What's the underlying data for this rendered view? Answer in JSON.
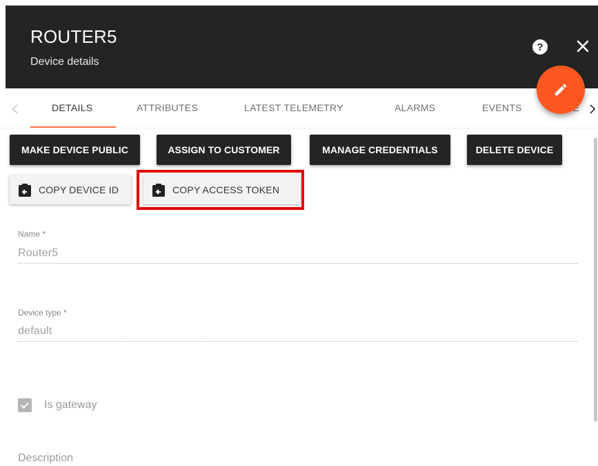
{
  "header": {
    "title": "ROUTER5",
    "subtitle": "Device details",
    "background_color": "#242424"
  },
  "icons": {
    "help": "help-icon",
    "close": "close-icon",
    "edit": "pencil-icon",
    "tab_prev": "chevron-left-icon",
    "tab_next": "chevron-right-icon",
    "copy": "clipboard-arrow-icon",
    "check": "checkmark-icon"
  },
  "fab": {
    "color": "#ff5722"
  },
  "tabs": [
    {
      "label": "DETAILS",
      "active": true
    },
    {
      "label": "ATTRIBUTES",
      "active": false
    },
    {
      "label": "LATEST TELEMETRY",
      "active": false
    },
    {
      "label": "ALARMS",
      "active": false
    },
    {
      "label": "EVENTS",
      "active": false
    },
    {
      "label": "RE",
      "active": false
    }
  ],
  "actions": {
    "make_public": "MAKE DEVICE PUBLIC",
    "assign_customer": "ASSIGN TO CUSTOMER",
    "manage_credentials": "MANAGE CREDENTIALS",
    "delete_device": "DELETE DEVICE",
    "copy_device_id": "COPY DEVICE ID",
    "copy_access_token": "COPY ACCESS TOKEN"
  },
  "highlight_color": "#e30000",
  "form": {
    "name": {
      "label": "Name",
      "required_mark": "*",
      "value": "Router5"
    },
    "device_type": {
      "label": "Device type",
      "required_mark": "*",
      "value": "default"
    },
    "is_gateway": {
      "label": "Is gateway",
      "checked": true
    },
    "description": {
      "label": "Description"
    }
  }
}
